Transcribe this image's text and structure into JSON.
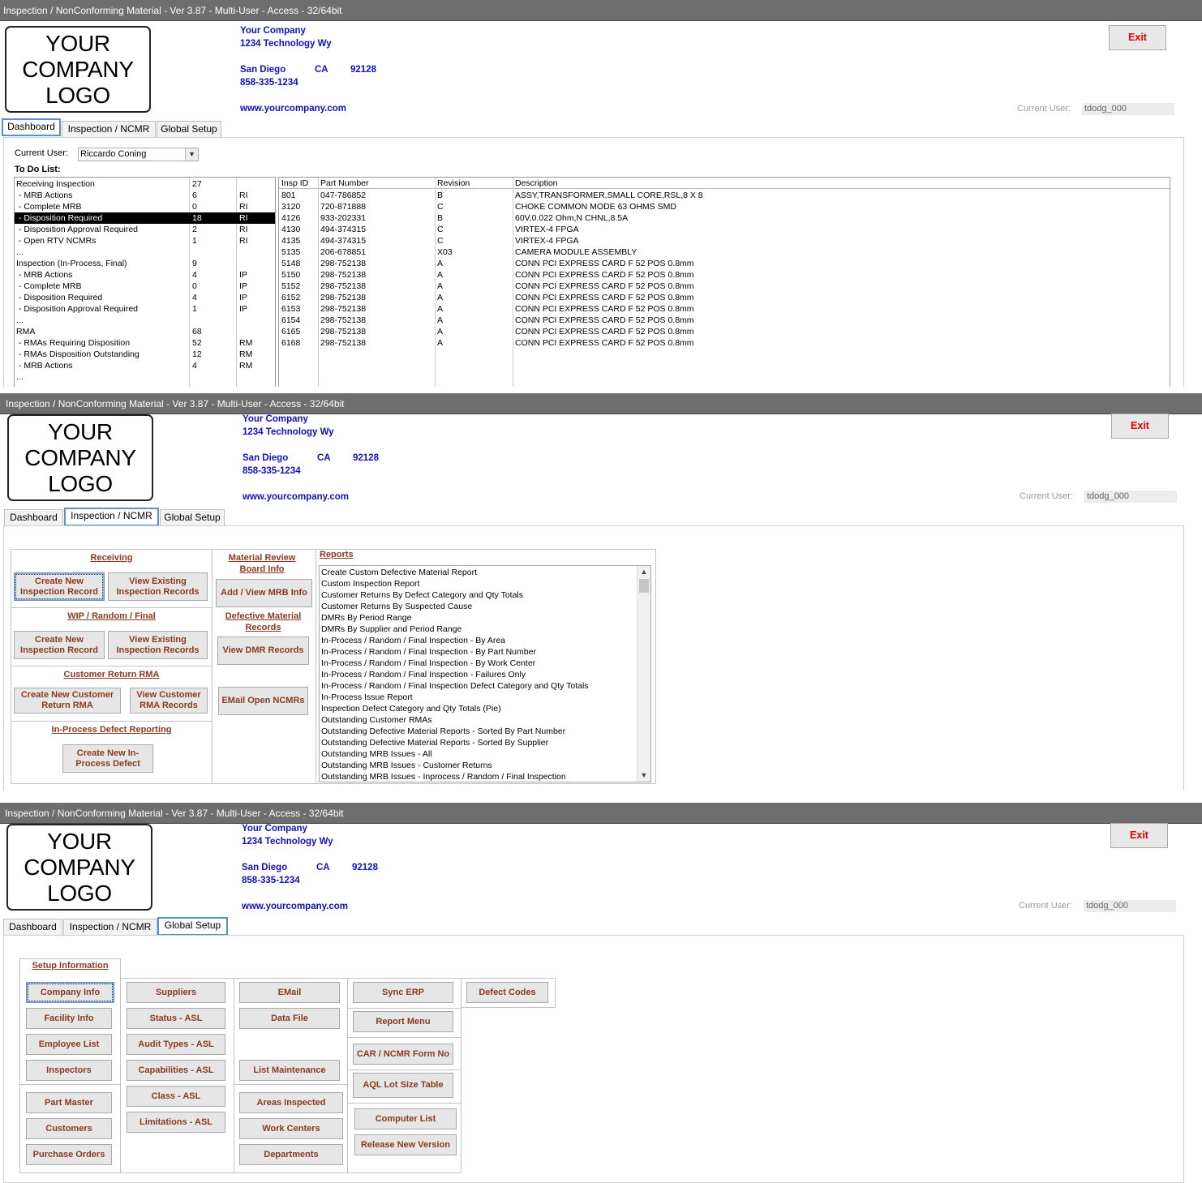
{
  "window_title": "Inspection / NonConforming Material - Ver 3.87 - Multi-User - Access - 32/64bit",
  "logo": {
    "line1": "YOUR",
    "line2": "COMPANY",
    "line3": "LOGO"
  },
  "company": {
    "name": "Your Company",
    "street": "1234 Technology Wy",
    "city": "San Diego",
    "state": "CA",
    "zip": "92128",
    "phone": "858-335-1234",
    "website": "www.yourcompany.com"
  },
  "exit_label": "Exit",
  "current_user_label": "Current User:",
  "current_user_value": "tdodg_000",
  "tabs": {
    "dashboard": "Dashboard",
    "inspection": "Inspection / NCMR",
    "setup": "Global Setup"
  },
  "dashboard": {
    "current_user_label": "Current User:",
    "current_user_select": "Riccardo Coning",
    "todo_label": "To Do List:",
    "todo": [
      {
        "label": "Receiving Inspection",
        "count": "27",
        "code": ""
      },
      {
        "label": " - MRB Actions",
        "count": "6",
        "code": "RI"
      },
      {
        "label": " - Complete MRB",
        "count": "0",
        "code": "RI"
      },
      {
        "label": " - Disposition Required",
        "count": "18",
        "code": "RI"
      },
      {
        "label": " - Disposition Approval Required",
        "count": "2",
        "code": "RI"
      },
      {
        "label": " - Open RTV NCMRs",
        "count": "1",
        "code": "RI"
      },
      {
        "label": "...",
        "count": "",
        "code": ""
      },
      {
        "label": "Inspection (In-Process, Final)",
        "count": "9",
        "code": ""
      },
      {
        "label": " - MRB Actions",
        "count": "4",
        "code": "IP"
      },
      {
        "label": " - Complete MRB",
        "count": "0",
        "code": "IP"
      },
      {
        "label": " - Disposition Required",
        "count": "4",
        "code": "IP"
      },
      {
        "label": " - Disposition Approval Required",
        "count": "1",
        "code": "IP"
      },
      {
        "label": "...",
        "count": "",
        "code": ""
      },
      {
        "label": "RMA",
        "count": "68",
        "code": ""
      },
      {
        "label": " - RMAs Requiring Disposition",
        "count": "52",
        "code": "RM"
      },
      {
        "label": " - RMAs Disposition Outstanding",
        "count": "12",
        "code": "RM"
      },
      {
        "label": " - MRB Actions",
        "count": "4",
        "code": "RM"
      },
      {
        "label": "...",
        "count": "",
        "code": ""
      }
    ],
    "grid_headers": {
      "insp_id": "Insp ID",
      "part": "Part Number",
      "rev": "Revision",
      "desc": "Description"
    },
    "grid": [
      {
        "insp_id": "801",
        "part": "047-786852",
        "rev": "B",
        "desc": "ASSY,TRANSFORMER,SMALL CORE,RSL,8 X 8"
      },
      {
        "insp_id": "3120",
        "part": "720-871888",
        "rev": "C",
        "desc": "CHOKE COMMON MODE 63 OHMS SMD"
      },
      {
        "insp_id": "4126",
        "part": "933-202331",
        "rev": "B",
        "desc": "60V,0.022 Ohm,N CHNL,8.5A"
      },
      {
        "insp_id": "4130",
        "part": "494-374315",
        "rev": "C",
        "desc": "VIRTEX-4 FPGA"
      },
      {
        "insp_id": "4135",
        "part": "494-374315",
        "rev": "C",
        "desc": "VIRTEX-4 FPGA"
      },
      {
        "insp_id": "5135",
        "part": "206-678851",
        "rev": "X03",
        "desc": "CAMERA MODULE ASSEMBLY"
      },
      {
        "insp_id": "5148",
        "part": "298-752138",
        "rev": "A",
        "desc": "CONN PCI EXPRESS CARD F 52 POS 0.8mm"
      },
      {
        "insp_id": "5150",
        "part": "298-752138",
        "rev": "A",
        "desc": "CONN PCI EXPRESS CARD F 52 POS 0.8mm"
      },
      {
        "insp_id": "5152",
        "part": "298-752138",
        "rev": "A",
        "desc": "CONN PCI EXPRESS CARD F 52 POS 0.8mm"
      },
      {
        "insp_id": "6152",
        "part": "298-752138",
        "rev": "A",
        "desc": "CONN PCI EXPRESS CARD F 52 POS 0.8mm"
      },
      {
        "insp_id": "6153",
        "part": "298-752138",
        "rev": "A",
        "desc": "CONN PCI EXPRESS CARD F 52 POS 0.8mm"
      },
      {
        "insp_id": "6154",
        "part": "298-752138",
        "rev": "A",
        "desc": "CONN PCI EXPRESS CARD F 52 POS 0.8mm"
      },
      {
        "insp_id": "6165",
        "part": "298-752138",
        "rev": "A",
        "desc": "CONN PCI EXPRESS CARD F 52 POS 0.8mm"
      },
      {
        "insp_id": "6168",
        "part": "298-752138",
        "rev": "A",
        "desc": "CONN PCI EXPRESS CARD F 52 POS 0.8mm"
      }
    ]
  },
  "inspection": {
    "receiving_header": "Receiving",
    "create_new_inspection": "Create New Inspection Record",
    "view_existing_inspection": "View Existing Inspection Records",
    "wip_header": "WIP / Random / Final",
    "create_new_inspection_wip": "Create New Inspection Record",
    "view_existing_inspection_wip": "View Existing Inspection Records",
    "rma_header": "Customer Return RMA",
    "create_rma": "Create New Customer Return RMA",
    "view_rma": "View Customer RMA Records",
    "inprocess_header": "In-Process Defect Reporting",
    "create_inprocess": "Create New In-Process Defect",
    "mrb_header": "Material Review Board Info",
    "add_view_mrb": "Add / View MRB Info",
    "dmr_header": "Defective Material Records",
    "view_dmr": "View DMR Records",
    "email_ncmr": "EMail Open NCMRs",
    "reports_header": "Reports",
    "reports": [
      "Create Custom Defective Material Report",
      "Custom Inspection Report",
      "Customer Returns By Defect Category and Qty Totals",
      "Customer Returns By Suspected Cause",
      "DMRs By Period Range",
      "DMRs By Supplier and Period Range",
      "In-Process / Random / Final Inspection - By Area",
      "In-Process / Random / Final Inspection - By Part Number",
      "In-Process / Random / Final Inspection - By Work Center",
      "In-Process / Random / Final Inspection - Failures Only",
      "In-Process / Random / Final Inspection Defect Category and Qty Totals",
      "In-Process Issue Report",
      "Inspection Defect Category and Qty Totals (Pie)",
      "Outstanding Customer RMAs",
      "Outstanding Defective Material Reports - Sorted By Part Number",
      "Outstanding Defective Material Reports - Sorted By Supplier",
      "Outstanding MRB Issues - All",
      "Outstanding MRB Issues - Customer Returns",
      "Outstanding MRB Issues - Inprocess / Random / Final Inspection"
    ]
  },
  "setup": {
    "header": "Setup Information",
    "col1": [
      "Company Info",
      "Facility Info",
      "Employee List",
      "Inspectors"
    ],
    "col1b": [
      "Part Master",
      "Customers",
      "Purchase Orders"
    ],
    "col2": [
      "Suppliers",
      "Status - ASL",
      "Audit Types - ASL",
      "Capabilities - ASL",
      "Class - ASL",
      "Limitations - ASL"
    ],
    "col3": [
      "EMail",
      "Data File"
    ],
    "col3_list": "List Maintenance",
    "col3b": [
      "Areas Inspected",
      "Work Centers",
      "Departments"
    ],
    "col4": [
      "Sync ERP",
      "Report Menu",
      "CAR / NCMR Form No",
      "AQL Lot Size Table",
      "Computer List",
      "Release New Version"
    ],
    "col5": [
      "Defect Codes"
    ]
  }
}
